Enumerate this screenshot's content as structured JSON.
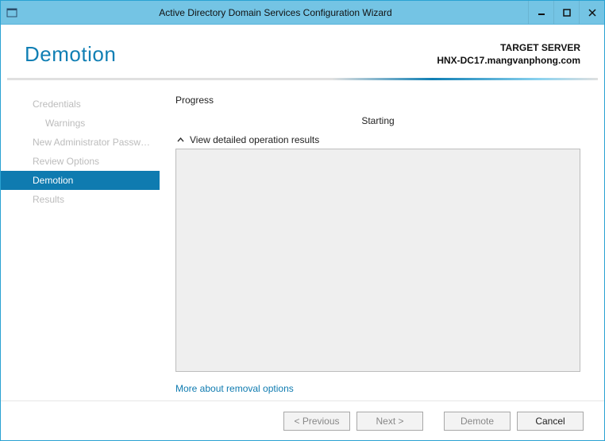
{
  "titlebar": {
    "title": "Active Directory Domain Services Configuration Wizard"
  },
  "header": {
    "title": "Demotion",
    "target_label": "TARGET SERVER",
    "target_server": "HNX-DC17.mangvanphong.com"
  },
  "sidebar": {
    "steps": [
      {
        "label": "Credentials"
      },
      {
        "label": "Warnings"
      },
      {
        "label": "New Administrator Passw…"
      },
      {
        "label": "Review Options"
      },
      {
        "label": "Demotion"
      },
      {
        "label": "Results"
      }
    ]
  },
  "main": {
    "progress_label": "Progress",
    "status": "Starting",
    "expander_label": "View detailed operation results",
    "more_link": "More about removal options"
  },
  "footer": {
    "previous": "< Previous",
    "next": "Next >",
    "demote": "Demote",
    "cancel": "Cancel"
  }
}
